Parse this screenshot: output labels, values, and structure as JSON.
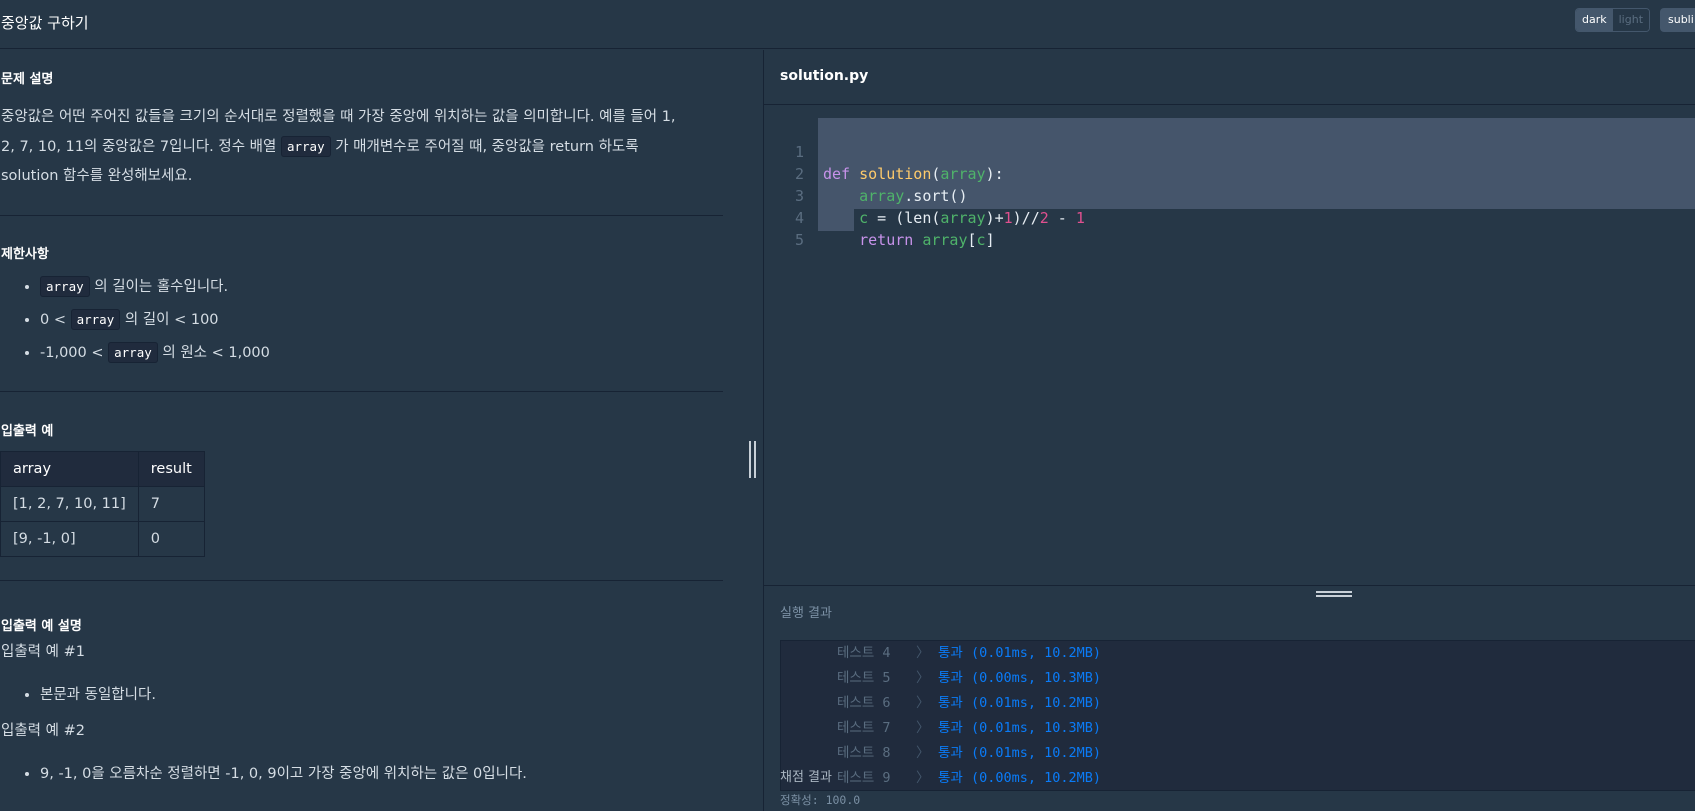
{
  "header": {
    "title": "중앙값 구하기",
    "theme_dark": "dark",
    "theme_light": "light",
    "editor_mode": "subli"
  },
  "problem": {
    "heading": "문제 설명",
    "desc_1": "중앙값은 어떤 주어진 값들을 크기의 순서대로 정렬했을 때 가장 중앙에 위치하는 값을 의미합니다. 예를 들어 1, 2, 7, 10, 11의 중앙값은 7입니다. 정수 배열 ",
    "desc_code": "array",
    "desc_2": " 가 매개변수로 주어질 때, 중앙값을 return 하도록 solution 함수를 완성해보세요."
  },
  "constraints": {
    "heading": "제한사항",
    "items": [
      {
        "pre": "",
        "code": "array",
        "post": " 의 길이는 홀수입니다."
      },
      {
        "pre": "0 < ",
        "code": "array",
        "post": " 의 길이 < 100"
      },
      {
        "pre": "-1,000 < ",
        "code": "array",
        "post": " 의 원소 < 1,000"
      }
    ]
  },
  "io_example": {
    "heading": "입출력 예",
    "columns": [
      "array",
      "result"
    ],
    "rows": [
      [
        "[1, 2, 7, 10, 11]",
        "7"
      ],
      [
        "[9, -1, 0]",
        "0"
      ]
    ]
  },
  "io_explanation": {
    "heading": "입출력 예 설명",
    "ex1_title": "입출력 예 #1",
    "ex1_item": "본문과 동일합니다.",
    "ex2_title": "입출력 예 #2",
    "ex2_item": "9, -1, 0을 오름차순 정렬하면 -1, 0, 9이고 가장 중앙에 위치하는 값은 0입니다."
  },
  "editor": {
    "filename": "solution.py",
    "line_numbers": [
      "1",
      "2",
      "3",
      "4",
      "5"
    ],
    "code": {
      "l1_def": "def",
      "l1_fn": "solution",
      "l1_open": "(",
      "l1_param": "array",
      "l1_close": "):",
      "l2_obj": "array",
      "l2_rest": ".sort()",
      "l3_var": "c",
      "l3_a": " = (len(",
      "l3_arr": "array",
      "l3_b": ")+",
      "l3_one": "1",
      "l3_c": ")//",
      "l3_two": "2",
      "l3_d": " - ",
      "l3_one2": "1",
      "l4_ret": "return",
      "l4_arr": "array",
      "l4_open": "[",
      "l4_c": "c",
      "l4_close": "]"
    }
  },
  "results": {
    "heading": "실행 결과",
    "arrow": "〉",
    "lines": [
      {
        "label": "테스트 4",
        "value": "통과 (0.01ms, 10.2MB)"
      },
      {
        "label": "테스트 5",
        "value": "통과 (0.00ms, 10.3MB)"
      },
      {
        "label": "테스트 6",
        "value": "통과 (0.01ms, 10.2MB)"
      },
      {
        "label": "테스트 7",
        "value": "통과 (0.01ms, 10.3MB)"
      },
      {
        "label": "테스트 8",
        "value": "통과 (0.01ms, 10.2MB)"
      },
      {
        "label": "테스트 9",
        "value": "통과 (0.00ms, 10.2MB)"
      }
    ],
    "grade_heading": "채점 결과",
    "accuracy": "정확성: 100.0"
  },
  "colors": {
    "background": "#263747",
    "border": "#172334",
    "pass": "#0a7bf7",
    "keyword": "#c792ea",
    "function": "#ffcb6b",
    "variable": "#4fb36a",
    "number": "#e0508f"
  }
}
